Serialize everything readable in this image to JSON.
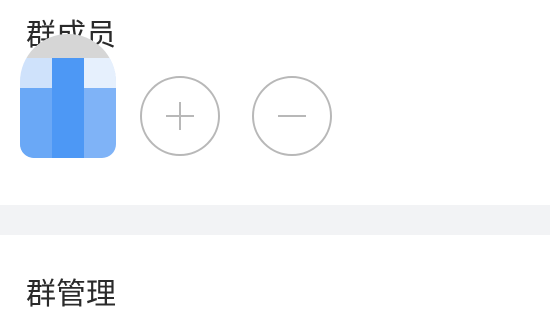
{
  "members_section": {
    "title": "群成员",
    "add_icon": "plus-icon",
    "remove_icon": "minus-icon"
  },
  "manage_row": {
    "label": "群管理"
  },
  "colors": {
    "text": "#2a2a2a",
    "icon_stroke": "#b8b8b8",
    "separator": "#f2f3f5",
    "avatar_blue": "#4d98f5"
  }
}
